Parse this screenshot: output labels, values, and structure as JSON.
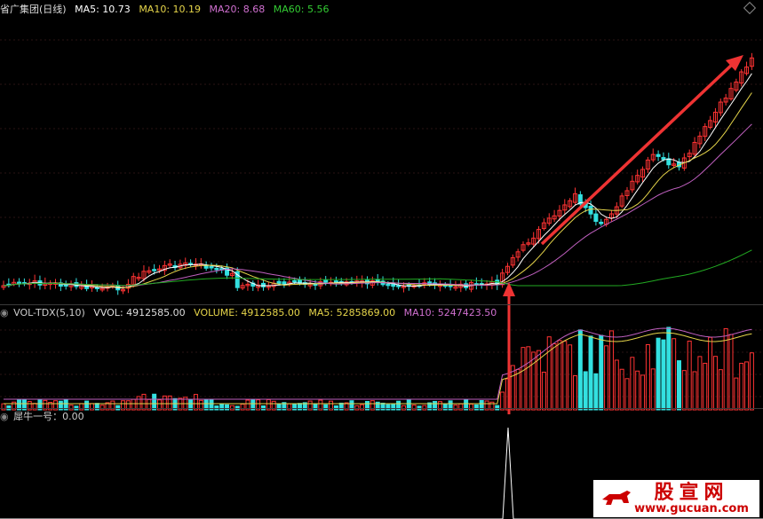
{
  "price_panel": {
    "title": "省广集团(日线)",
    "ma5": "MA5: 10.73",
    "ma10": "MA10: 10.19",
    "ma20": "MA20: 8.68",
    "ma60": "MA60: 5.56"
  },
  "volume_panel": {
    "title": "VOL-TDX(5,10)",
    "vvol": "VVOL: 4912585.00",
    "volume": "VOLUME: 4912585.00",
    "ma5": "MA5: 5285869.00",
    "ma10": "MA10: 5247423.50"
  },
  "indicator_panel": {
    "title": "犀牛一号：0.00"
  },
  "watermark": {
    "cn": "股宣网",
    "en": "www.gucuan.com"
  },
  "colors": {
    "up": "#ff3333",
    "down": "#33e0e0",
    "ma5": "#ffffff",
    "ma10": "#e6d54a",
    "ma20": "#c060c0",
    "ma60": "#22aa22",
    "arrow": "#ee3333"
  }
}
